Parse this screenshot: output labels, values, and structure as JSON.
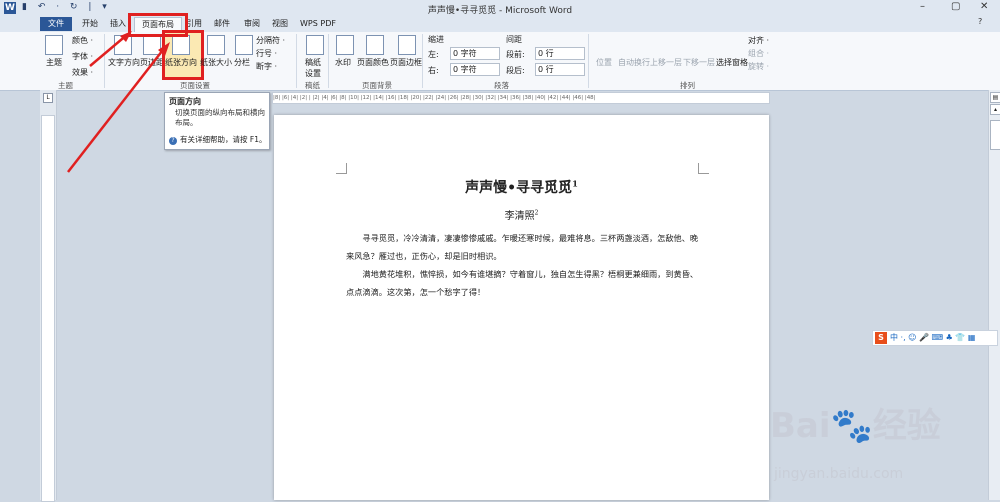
{
  "window": {
    "title": "声声慢•寻寻觅觅 - Microsoft Word",
    "logo": "W",
    "qat": "▮ ↶ · ↻ | ▾",
    "minimize": "–",
    "restore": "▢",
    "close": "✕",
    "help": "?"
  },
  "tabs": [
    "文件",
    "开始",
    "插入",
    "页面布局",
    "引用",
    "邮件",
    "审阅",
    "视图",
    "WPS PDF"
  ],
  "ribbon": {
    "theme": {
      "label": "主题",
      "colors": "颜色 ·",
      "fonts": "字体 ·",
      "effects": "效果 ·",
      "group": "主题"
    },
    "page_setup": {
      "text_direction": "文字方向",
      "margins": "页边距",
      "orientation": "纸张方向",
      "size": "纸张大小",
      "columns": "分栏",
      "breaks": "分隔符 ·",
      "line_numbers": "行号 ·",
      "hyphenation": "断字 ·",
      "group": "页面设置"
    },
    "draft": {
      "label_line1": "稿纸",
      "label_line2": "设置",
      "group": "稿纸"
    },
    "background": {
      "watermark": "水印",
      "page_color": "页面颜色",
      "page_borders": "页面边框",
      "group": "页面背景"
    },
    "paragraph": {
      "indent_title": "缩进",
      "spacing_title": "间距",
      "left": "左:",
      "right": "右:",
      "before": "段前:",
      "after": "段后:",
      "left_value": "0 字符",
      "right_value": "0 字符",
      "before_value": "0 行",
      "after_value": "0 行",
      "group": "段落"
    },
    "arrange": {
      "position": "位置",
      "wrap": "自动换行",
      "bring_forward": "上移一层",
      "send_backward": "下移一层",
      "selection_pane": "选择窗格",
      "align": "对齐 ·",
      "group_btn": "组合 ·",
      "rotate": "旋转 ·",
      "group": "排列"
    }
  },
  "tooltip": {
    "title": "页面方向",
    "body": "切换页面的纵向布局和横向布局。",
    "help": "有关详细帮助，请按 F1。"
  },
  "ruler": {
    "h_ticks": "|8| |6| |4| |2| | |2| |4| |6| |8| |10| |12| |14| |16| |18| |20| |22| |24| |26| |28| |30| |32| |34| |36| |38| |40| |42| |44| |46| |48|",
    "tab_selector": "L"
  },
  "document": {
    "title": "声声慢•寻寻觅觅",
    "title_note": "1",
    "author": "李清照",
    "author_note": "2",
    "paragraphs": [
      "寻寻觅觅，冷冷清清，凄凄惨惨戚戚。乍暖还寒时候，最难将息。三杯两盏淡酒，怎敌他、晚来风急？雁过也，正伤心，却是旧时相识。",
      "满地黄花堆积，憔悴损，如今有谁堪摘？守着窗儿，独自怎生得黑？梧桐更兼细雨，到黄昏、点点滴滴。这次第，怎一个愁字了得！"
    ]
  },
  "ime_bar": {
    "logo": "S",
    "text": "中 ·, ☺ 🎤 ⌨ ♣ 👕 ▦"
  },
  "watermark": {
    "logo": "Bai🐾经验",
    "url": "jingyan.baidu.com"
  },
  "colors": {
    "highlight_red": "#e02020",
    "word_blue": "#2b5797"
  }
}
